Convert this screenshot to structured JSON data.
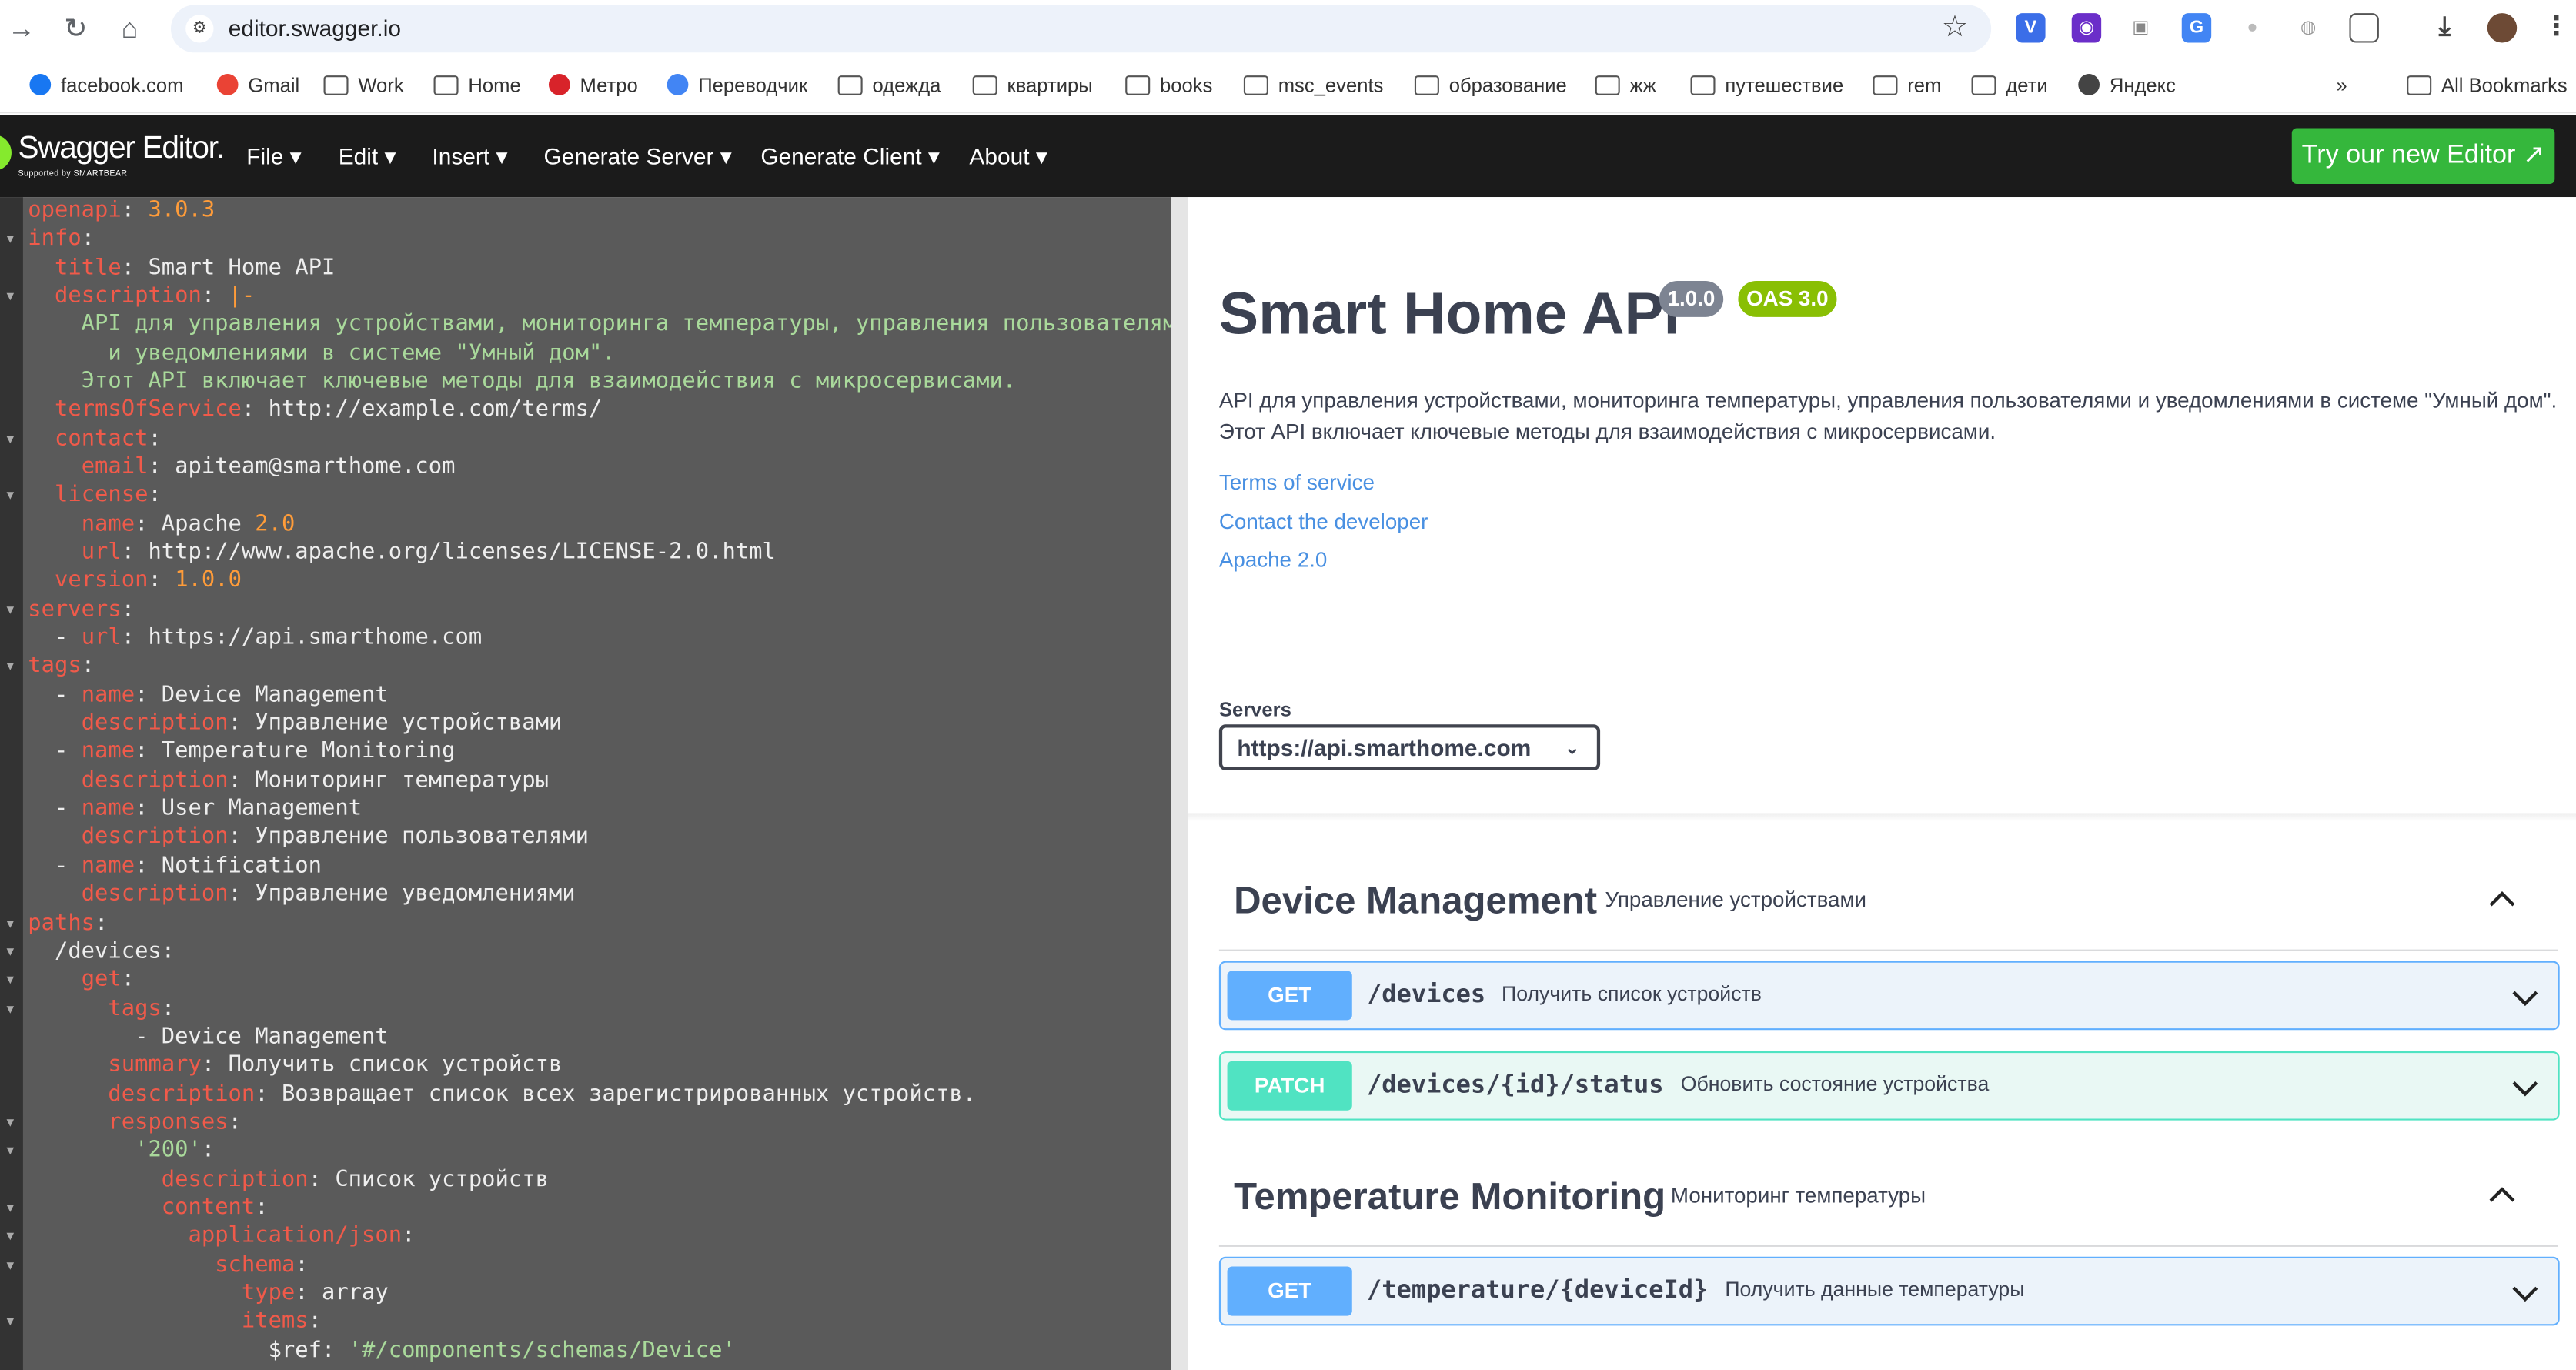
{
  "browser": {
    "url": "editor.swagger.io",
    "bookmarks": [
      {
        "label": "facebook.com",
        "icon": "facebook-icon"
      },
      {
        "label": "Gmail",
        "icon": "gmail-icon"
      },
      {
        "label": "Work",
        "icon": "folder-icon"
      },
      {
        "label": "Home",
        "icon": "folder-icon"
      },
      {
        "label": "Метро",
        "icon": "metro-icon"
      },
      {
        "label": "Переводчик",
        "icon": "translate-icon"
      },
      {
        "label": "одежда",
        "icon": "folder-icon"
      },
      {
        "label": "квартиры",
        "icon": "folder-icon"
      },
      {
        "label": "books",
        "icon": "folder-icon"
      },
      {
        "label": "msc_events",
        "icon": "folder-icon"
      },
      {
        "label": "образование",
        "icon": "folder-icon"
      },
      {
        "label": "жж",
        "icon": "folder-icon"
      },
      {
        "label": "путешествие",
        "icon": "folder-icon"
      },
      {
        "label": "rem",
        "icon": "folder-icon"
      },
      {
        "label": "дети",
        "icon": "folder-icon"
      },
      {
        "label": "Яндекс",
        "icon": "globe-icon"
      }
    ],
    "more_bookmarks": "»",
    "all_bookmarks": "All Bookmarks"
  },
  "header": {
    "logo": "Swagger Editor.",
    "logo_sub": "Supported by SMARTBEAR",
    "menu": [
      "File ▾",
      "Edit ▾",
      "Insert ▾",
      "Generate Server ▾",
      "Generate Client ▾",
      "About ▾"
    ],
    "try_button": "Try our new Editor ↗"
  },
  "editor": {
    "lines": [
      [
        [
          "k",
          "openapi"
        ],
        [
          "v",
          ": "
        ],
        [
          "n",
          "3.0.3"
        ]
      ],
      [
        [
          "k",
          "info"
        ],
        [
          "v",
          ":"
        ]
      ],
      [
        [
          "v",
          "  "
        ],
        [
          "k",
          "title"
        ],
        [
          "v",
          ": Smart Home API"
        ]
      ],
      [
        [
          "v",
          "  "
        ],
        [
          "k",
          "description"
        ],
        [
          "v",
          ": "
        ],
        [
          "n",
          "|-"
        ]
      ],
      [
        [
          "s",
          "    API для управления устройствами, мониторинга температуры, управления пользователями"
        ]
      ],
      [
        [
          "s",
          "      и уведомлениями в системе \"Умный дом\"."
        ]
      ],
      [
        [
          "s",
          "    Этот API включает ключевые методы для взаимодействия с микросервисами."
        ]
      ],
      [
        [
          "v",
          "  "
        ],
        [
          "k",
          "termsOfService"
        ],
        [
          "v",
          ": http://example.com/terms/"
        ]
      ],
      [
        [
          "v",
          "  "
        ],
        [
          "k",
          "contact"
        ],
        [
          "v",
          ":"
        ]
      ],
      [
        [
          "v",
          "    "
        ],
        [
          "k",
          "email"
        ],
        [
          "v",
          ": apiteam@smarthome.com"
        ]
      ],
      [
        [
          "v",
          "  "
        ],
        [
          "k",
          "license"
        ],
        [
          "v",
          ":"
        ]
      ],
      [
        [
          "v",
          "    "
        ],
        [
          "k",
          "name"
        ],
        [
          "v",
          ": Apache "
        ],
        [
          "n",
          "2.0"
        ]
      ],
      [
        [
          "v",
          "    "
        ],
        [
          "k",
          "url"
        ],
        [
          "v",
          ": http://www.apache.org/licenses/LICENSE-2.0.html"
        ]
      ],
      [
        [
          "v",
          "  "
        ],
        [
          "k",
          "version"
        ],
        [
          "v",
          ": "
        ],
        [
          "n",
          "1.0.0"
        ]
      ],
      [
        [
          "k",
          "servers"
        ],
        [
          "v",
          ":"
        ]
      ],
      [
        [
          "v",
          "  - "
        ],
        [
          "k",
          "url"
        ],
        [
          "v",
          ": https://api.smarthome.com"
        ]
      ],
      [
        [
          "k",
          "tags"
        ],
        [
          "v",
          ":"
        ]
      ],
      [
        [
          "v",
          "  - "
        ],
        [
          "k",
          "name"
        ],
        [
          "v",
          ": Device Management"
        ]
      ],
      [
        [
          "v",
          "    "
        ],
        [
          "k",
          "description"
        ],
        [
          "v",
          ": Управление устройствами"
        ]
      ],
      [
        [
          "v",
          "  - "
        ],
        [
          "k",
          "name"
        ],
        [
          "v",
          ": Temperature Monitoring"
        ]
      ],
      [
        [
          "v",
          "    "
        ],
        [
          "k",
          "description"
        ],
        [
          "v",
          ": Мониторинг температуры"
        ]
      ],
      [
        [
          "v",
          "  - "
        ],
        [
          "k",
          "name"
        ],
        [
          "v",
          ": User Management"
        ]
      ],
      [
        [
          "v",
          "    "
        ],
        [
          "k",
          "description"
        ],
        [
          "v",
          ": Управление пользователями"
        ]
      ],
      [
        [
          "v",
          "  - "
        ],
        [
          "k",
          "name"
        ],
        [
          "v",
          ": Notification"
        ]
      ],
      [
        [
          "v",
          "    "
        ],
        [
          "k",
          "description"
        ],
        [
          "v",
          ": Управление уведомлениями"
        ]
      ],
      [
        [
          "k",
          "paths"
        ],
        [
          "v",
          ":"
        ]
      ],
      [
        [
          "v",
          "  /devices:"
        ]
      ],
      [
        [
          "v",
          "    "
        ],
        [
          "k",
          "get"
        ],
        [
          "v",
          ":"
        ]
      ],
      [
        [
          "v",
          "      "
        ],
        [
          "k",
          "tags"
        ],
        [
          "v",
          ":"
        ]
      ],
      [
        [
          "v",
          "        - Device Management"
        ]
      ],
      [
        [
          "v",
          "      "
        ],
        [
          "k",
          "summary"
        ],
        [
          "v",
          ": Получить список устройств"
        ]
      ],
      [
        [
          "v",
          "      "
        ],
        [
          "k",
          "description"
        ],
        [
          "v",
          ": Возвращает список всех зарегистрированных устройств."
        ]
      ],
      [
        [
          "v",
          "      "
        ],
        [
          "k",
          "responses"
        ],
        [
          "v",
          ":"
        ]
      ],
      [
        [
          "v",
          "        "
        ],
        [
          "s",
          "'200'"
        ],
        [
          "v",
          ":"
        ]
      ],
      [
        [
          "v",
          "          "
        ],
        [
          "k",
          "description"
        ],
        [
          "v",
          ": Список устройств"
        ]
      ],
      [
        [
          "v",
          "          "
        ],
        [
          "k",
          "content"
        ],
        [
          "v",
          ":"
        ]
      ],
      [
        [
          "v",
          "            "
        ],
        [
          "k",
          "application/json"
        ],
        [
          "v",
          ":"
        ]
      ],
      [
        [
          "v",
          "              "
        ],
        [
          "k",
          "schema"
        ],
        [
          "v",
          ":"
        ]
      ],
      [
        [
          "v",
          "                "
        ],
        [
          "k",
          "type"
        ],
        [
          "v",
          ": array"
        ]
      ],
      [
        [
          "v",
          "                "
        ],
        [
          "k",
          "items"
        ],
        [
          "v",
          ":"
        ]
      ],
      [
        [
          "v",
          "                  $ref: "
        ],
        [
          "s",
          "'#/components/schemas/Device'"
        ]
      ]
    ]
  },
  "api": {
    "title": "Smart Home API",
    "version_badge": "1.0.0",
    "oas_badge": "OAS 3.0",
    "description": "API для управления устройствами, мониторинга температуры, управления пользователями и уведомлениями в системе \"Умный дом\". Этот API включает ключевые методы для взаимодействия с микросервисами.",
    "links": [
      "Terms of service",
      "Contact the developer",
      "Apache 2.0"
    ],
    "servers_label": "Servers",
    "server_selected": "https://api.smarthome.com"
  },
  "tags": [
    {
      "name": "Device Management",
      "description": "Управление устройствами",
      "operations": [
        {
          "method": "GET",
          "path": "/devices",
          "summary": "Получить список устройств"
        },
        {
          "method": "PATCH",
          "path": "/devices/{id}/status",
          "summary": "Обновить состояние устройства"
        }
      ]
    },
    {
      "name": "Temperature Monitoring",
      "description": "Мониторинг температуры",
      "operations": [
        {
          "method": "GET",
          "path": "/temperature/{deviceId}",
          "summary": "Получить данные температуры"
        }
      ]
    }
  ],
  "colors": {
    "get": "#61affe",
    "patch": "#50e3c2",
    "yaml_key": "#f05a4a",
    "yaml_number": "#ff9c39",
    "yaml_string": "#a9d99b",
    "try_button": "#35b73c"
  }
}
